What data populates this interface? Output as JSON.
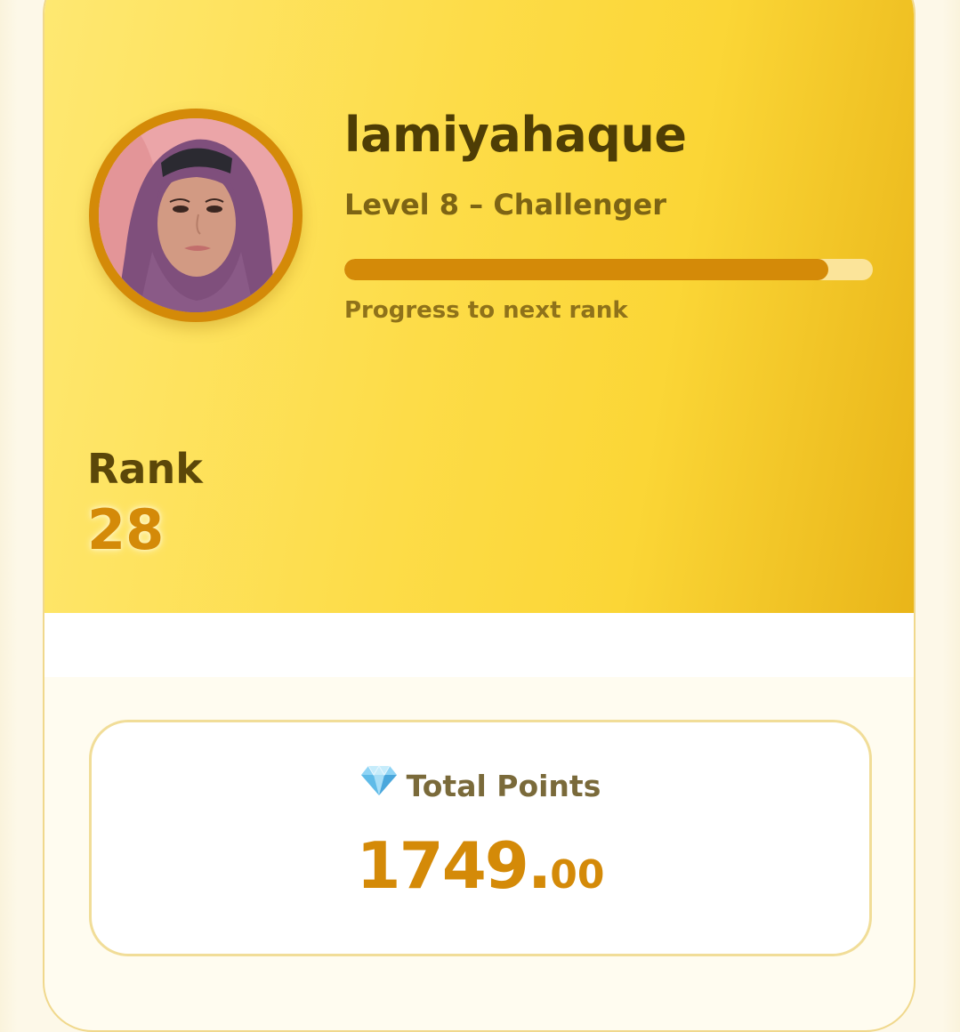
{
  "profile": {
    "username": "lamiyahaque",
    "level": "Level 8 – Challenger",
    "progress_label": "Progress to next rank",
    "progress_fraction": 0.915,
    "avatar_icon": "user-avatar-photo"
  },
  "rank": {
    "label": "Rank",
    "value": "28"
  },
  "points": {
    "icon": "gem-icon",
    "title": "Total Points",
    "integer_part": "1749.",
    "decimal_part": "00"
  },
  "colors": {
    "accent": "#d48a08",
    "hero_start": "#fee872",
    "hero_end": "#e9b519",
    "text_dark": "#4e3d05"
  }
}
